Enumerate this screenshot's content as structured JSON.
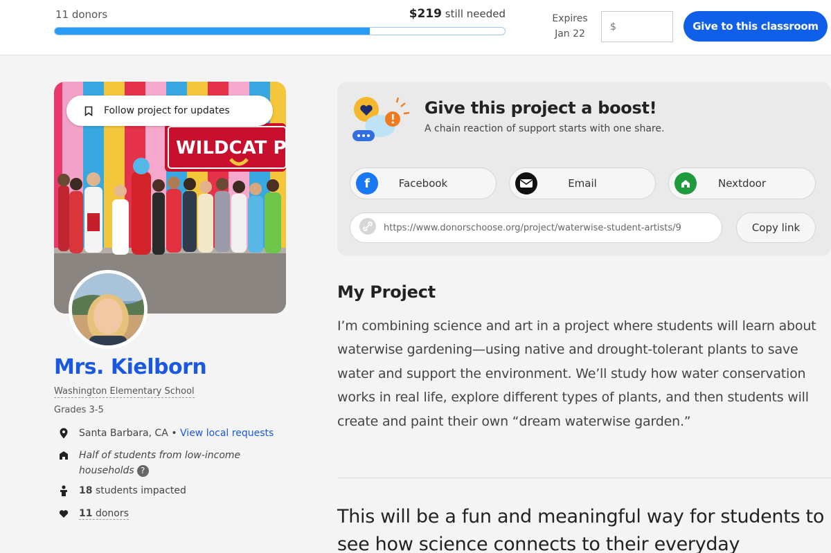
{
  "topbar": {
    "donors_count": "11 donors",
    "amount_needed": "$219",
    "still_needed_text": "still needed",
    "progress_percent": 70,
    "expires_label": "Expires",
    "expires_date": "Jan 22",
    "amount_placeholder": "$",
    "give_button": "Give to this classroom"
  },
  "profile": {
    "follow_button": "Follow project for updates",
    "banner_text": "WILDCAT PR",
    "teacher_name": "Mrs. Kielborn",
    "school": "Washington Elementary School",
    "grades": "Grades 3-5",
    "location": "Santa Barbara, CA",
    "separator": "•",
    "local_requests_link": "View local requests",
    "income_note": "Half of students from low‑income households",
    "help_icon_glyph": "?",
    "students_count": "18",
    "students_label": "students impacted",
    "donors_count": "11",
    "donors_label": "donors"
  },
  "boost": {
    "title": "Give this project a boost!",
    "subtitle": "A chain reaction of support starts with one share.",
    "share_buttons": [
      {
        "label": "Facebook",
        "icon": "facebook-icon",
        "color": "#1877f2"
      },
      {
        "label": "Email",
        "icon": "email-icon",
        "color": "#111111"
      },
      {
        "label": "Nextdoor",
        "icon": "nextdoor-icon",
        "color": "#1f9a3c"
      }
    ],
    "share_url": "https://www.donorschoose.org/project/waterwise-student-artists/9",
    "copy_button": "Copy link"
  },
  "project": {
    "section_title": "My Project",
    "description": "I’m combining science and art in a project where students will learn about waterwise gardening—using native and drought-tolerant plants to save water and support the environment. We’ll study how water conservation works in real life, explore different types of plants, and then students will create and paint their own “dream waterwise garden.”",
    "highlight": "This will be a fun and meaningful way for students to see how science connects to their everyday"
  },
  "colors": {
    "brand_blue": "#0f5fe8",
    "progress_blue": "#2b9af3",
    "name_blue": "#1a58e0"
  }
}
